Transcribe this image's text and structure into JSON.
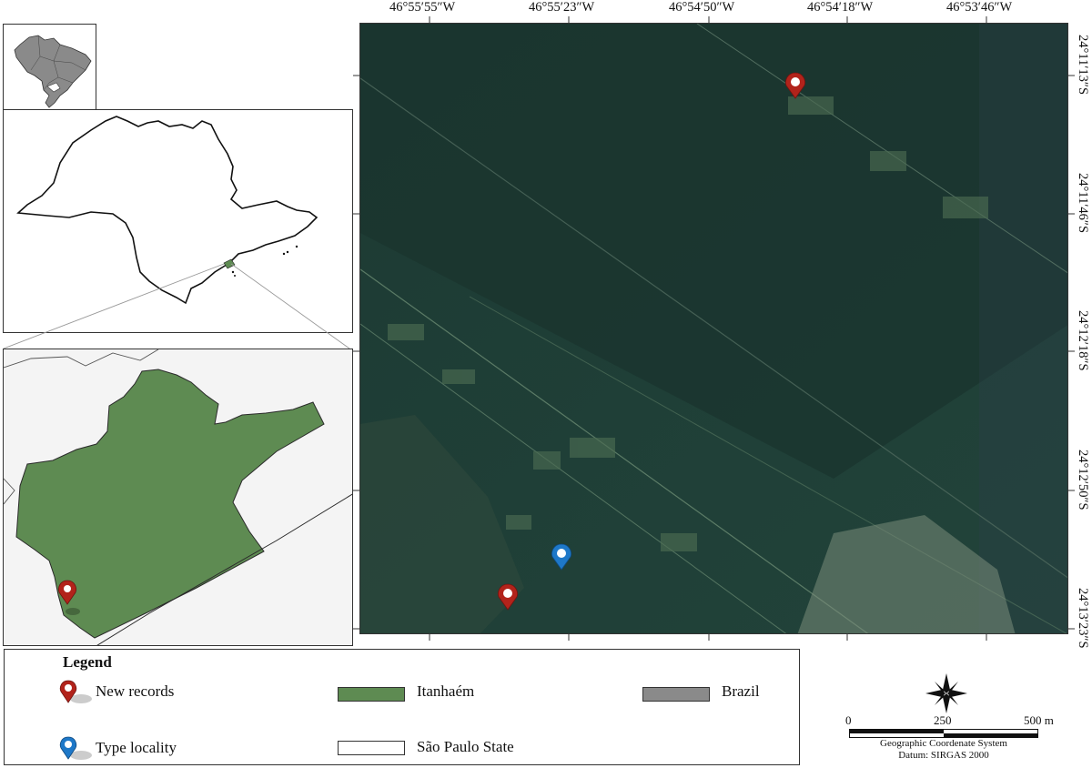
{
  "colors": {
    "itanhaem": "#5e8b52",
    "brazil": "#8a8a8a",
    "sao_paulo_state": "#ffffff",
    "pin_new": "#b2231b",
    "pin_type": "#1e78c8",
    "satellite_base": "#1e3b35"
  },
  "map_top_labels": [
    "46°55′55″W",
    "46°55′23″W",
    "46°54′50″W",
    "46°54′18″W",
    "46°53′46″W"
  ],
  "map_right_labels": [
    "24°11′13″S",
    "24°11′46″S",
    "24°12′18″S",
    "24°12′50″S",
    "24°13′23″S"
  ],
  "legend": {
    "title": "Legend",
    "new_records": "New records",
    "type_locality": "Type locality",
    "itanhaem": "Itanhaém",
    "sao_paulo_state": "São Paulo State",
    "brazil": "Brazil"
  },
  "scale": {
    "tick0": "0",
    "tick1": "250",
    "tick2": "500 m",
    "crs": "Geographic Coordenate System",
    "datum": "Datum: SIRGAS 2000"
  },
  "icons": [
    "north-arrow-icon",
    "map-pin-icon"
  ]
}
